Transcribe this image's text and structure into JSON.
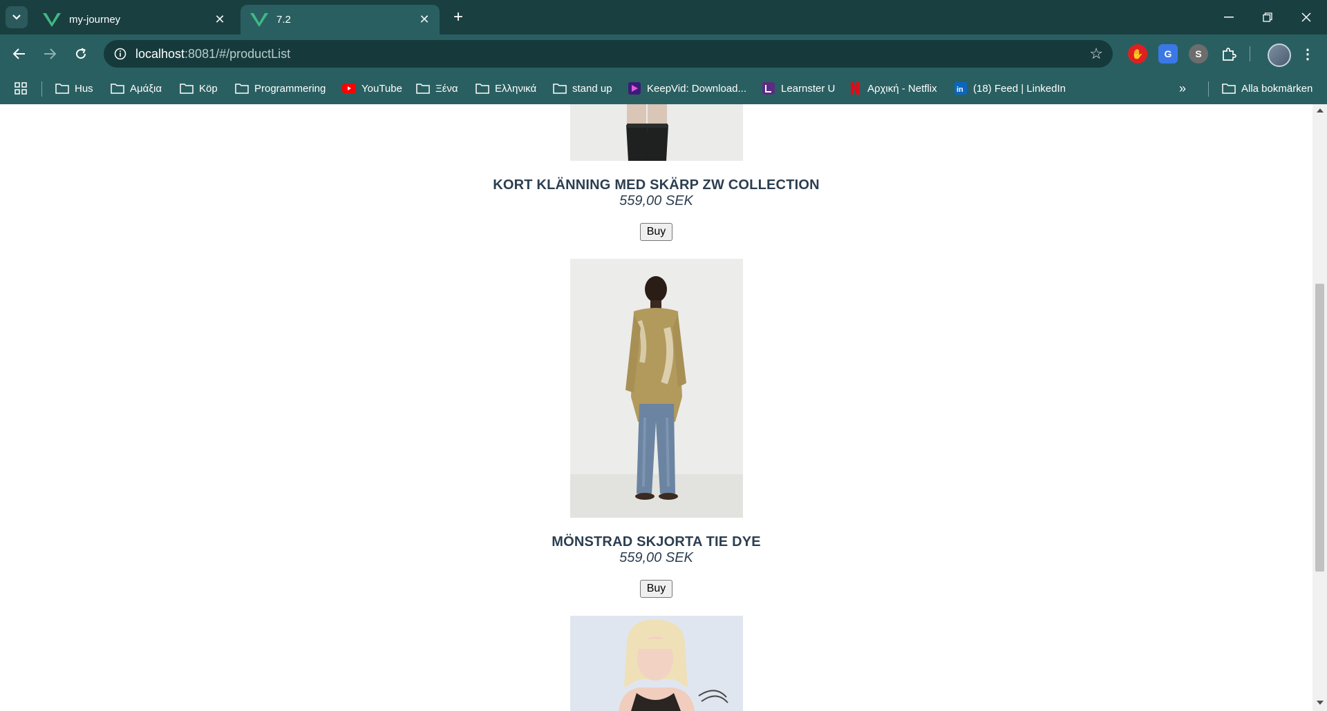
{
  "browser": {
    "tabs": [
      {
        "title": "my-journey",
        "active": false
      },
      {
        "title": "7.2",
        "active": true
      }
    ],
    "url_host": "localhost",
    "url_rest": ":8081/#/productList",
    "bookmarks": [
      {
        "label": "Hus",
        "icon": "folder-icon"
      },
      {
        "label": "Αμάξια",
        "icon": "folder-icon"
      },
      {
        "label": "Köp",
        "icon": "folder-icon"
      },
      {
        "label": "Programmering",
        "icon": "folder-icon"
      },
      {
        "label": "YouTube",
        "icon": "youtube-icon"
      },
      {
        "label": "Ξένα",
        "icon": "folder-icon"
      },
      {
        "label": "Ελληνικά",
        "icon": "folder-icon"
      },
      {
        "label": "stand up",
        "icon": "folder-icon"
      },
      {
        "label": "KeepVid: Download...",
        "icon": "keepvid-icon"
      },
      {
        "label": "Learnster U",
        "icon": "learnster-icon"
      },
      {
        "label": "Αρχική - Netflix",
        "icon": "netflix-icon"
      },
      {
        "label": "(18) Feed | LinkedIn",
        "icon": "linkedin-icon"
      }
    ],
    "all_bookmarks_label": "Alla bokmärken"
  },
  "products": [
    {
      "name": "KORT KLÄNNING MED SKÄRP ZW COLLECTION",
      "price": "559,00 SEK",
      "buy_label": "Buy"
    },
    {
      "name": "MÖNSTRAD SKJORTA TIE DYE",
      "price": "559,00 SEK",
      "buy_label": "Buy"
    }
  ],
  "colors": {
    "chrome_dark": "#1a3f41",
    "chrome": "#2a5f61",
    "product_text": "#2c3e50"
  }
}
